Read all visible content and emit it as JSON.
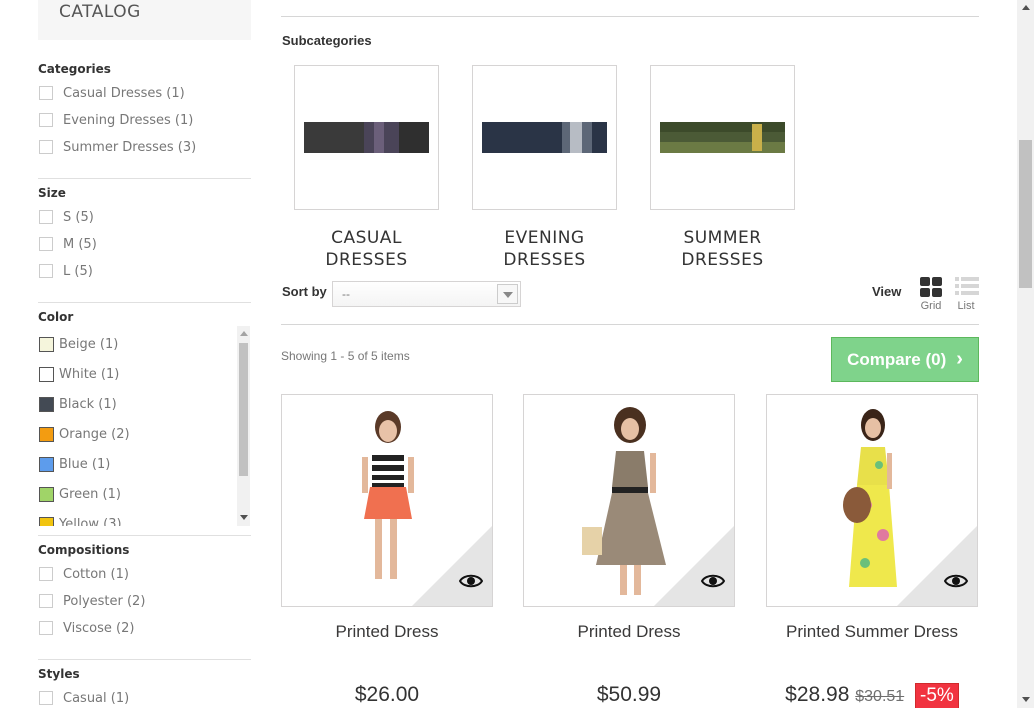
{
  "sidebar": {
    "catalog_title": "CATALOG",
    "categories": {
      "title": "Categories",
      "items": [
        "Casual Dresses (1)",
        "Evening Dresses (1)",
        "Summer Dresses (3)"
      ]
    },
    "size": {
      "title": "Size",
      "items": [
        "S (5)",
        "M (5)",
        "L (5)"
      ]
    },
    "color": {
      "title": "Color",
      "items": [
        {
          "label": "Beige (1)",
          "color": "#f5f5dc"
        },
        {
          "label": "White (1)",
          "color": "#ffffff"
        },
        {
          "label": "Black (1)",
          "color": "#434a54"
        },
        {
          "label": "Orange (2)",
          "color": "#f39c11"
        },
        {
          "label": "Blue (1)",
          "color": "#5d9cec"
        },
        {
          "label": "Green (1)",
          "color": "#a0d468"
        },
        {
          "label": "Yellow (3)",
          "color": "#f1c40f"
        }
      ]
    },
    "compositions": {
      "title": "Compositions",
      "items": [
        "Cotton (1)",
        "Polyester (2)",
        "Viscose (2)"
      ]
    },
    "styles": {
      "title": "Styles",
      "items": [
        "Casual (1)"
      ]
    }
  },
  "main": {
    "subcategories_title": "Subcategories",
    "subcategories": [
      {
        "line1": "CASUAL",
        "line2": "DRESSES"
      },
      {
        "line1": "EVENING",
        "line2": "DRESSES"
      },
      {
        "line1": "SUMMER",
        "line2": "DRESSES"
      }
    ],
    "sort_label": "Sort by",
    "sort_value": "--",
    "view_label": "View",
    "view_grid": "Grid",
    "view_list": "List",
    "showing": "Showing 1 - 5 of 5 items",
    "compare_label": "Compare (0)",
    "products": [
      {
        "name": "Printed Dress",
        "price": "$26.00",
        "old_price": "",
        "discount": ""
      },
      {
        "name": "Printed Dress",
        "price": "$50.99",
        "old_price": "",
        "discount": ""
      },
      {
        "name": "Printed Summer Dress",
        "price": "$28.98",
        "old_price": "$30.51",
        "discount": "-5%"
      }
    ]
  },
  "colors": {
    "compare_green": "#7fd38b",
    "discount_red": "#f13340"
  }
}
